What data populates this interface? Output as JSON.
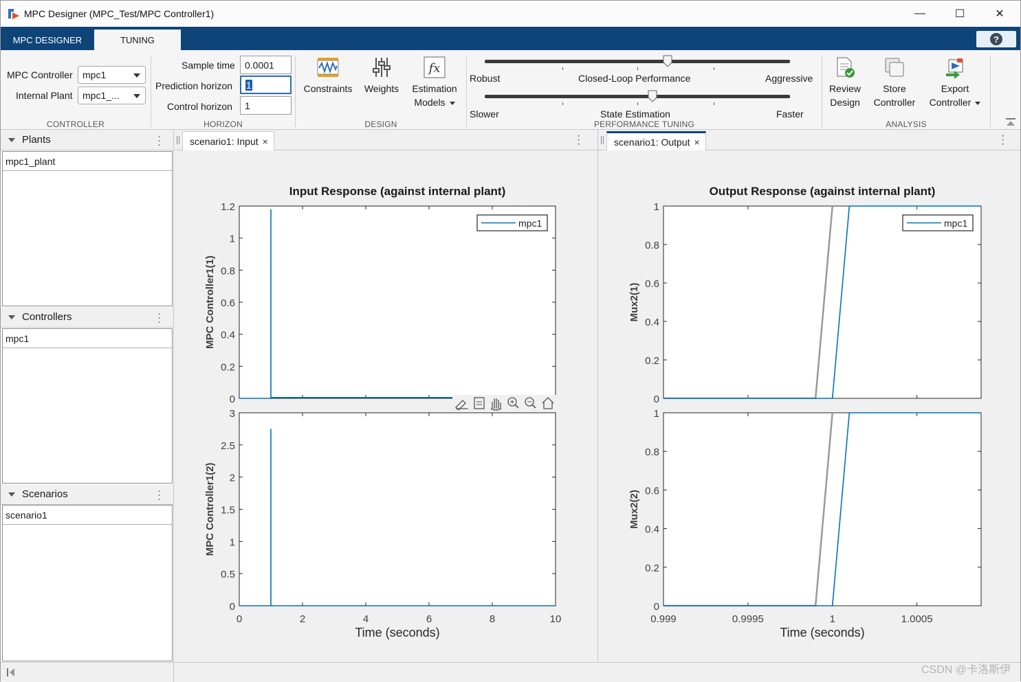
{
  "window": {
    "title": "MPC Designer (MPC_Test/MPC Controller1)",
    "minimize": "—",
    "maximize": "☐",
    "close": "✕"
  },
  "ribbon": {
    "tabs": [
      {
        "label": "MPC DESIGNER"
      },
      {
        "label": "TUNING"
      }
    ],
    "help": "?"
  },
  "controller_section": {
    "title": "CONTROLLER",
    "mpc_controller_label": "MPC Controller",
    "mpc_controller_value": "mpc1",
    "internal_plant_label": "Internal Plant",
    "internal_plant_value": "mpc1_..."
  },
  "horizon_section": {
    "title": "HORIZON",
    "sample_time_label": "Sample time",
    "sample_time_value": "0.0001",
    "prediction_horizon_label": "Prediction horizon",
    "prediction_horizon_value": "1",
    "control_horizon_label": "Control horizon",
    "control_horizon_value": "1"
  },
  "design_section": {
    "title": "DESIGN",
    "constraints": "Constraints",
    "weights": "Weights",
    "estimation_line1": "Estimation",
    "estimation_line2": "Models"
  },
  "performance_section": {
    "title": "PERFORMANCE TUNING",
    "slider1_left": "Robust",
    "slider1_center": "Closed-Loop Performance",
    "slider1_right": "Aggressive",
    "slider1_value": 0.6,
    "slider2_left": "Slower",
    "slider2_center": "State Estimation",
    "slider2_right": "Faster",
    "slider2_value": 0.55
  },
  "analysis_section": {
    "title": "ANALYSIS",
    "review_line1": "Review",
    "review_line2": "Design",
    "store_line1": "Store",
    "store_line2": "Controller",
    "export_line1": "Export",
    "export_line2": "Controller"
  },
  "left_panel": {
    "plants_title": "Plants",
    "plants_item": "mpc1_plant",
    "controllers_title": "Controllers",
    "controllers_item": "mpc1",
    "scenarios_title": "Scenarios",
    "scenarios_item": "scenario1"
  },
  "input_tab": "scenario1: Input",
  "output_tab": "scenario1: Output",
  "tab_close": "×",
  "colors": {
    "accent": "#0e4478",
    "series": "#0072bd",
    "reference": "#999999"
  },
  "watermark": "CSDN @卡洛斯伊",
  "chart_data": [
    {
      "type": "line",
      "title": "Input Response (against internal plant)",
      "xlabel": "Time (seconds)",
      "ylabel": "MPC Controller1(1)",
      "xlim": [
        0,
        10
      ],
      "ylim": [
        0,
        1.2
      ],
      "yticks": [
        0,
        0.2,
        0.4,
        0.6,
        0.8,
        1,
        1.2
      ],
      "ytick_labels": [
        "0",
        "0.2",
        "0.4",
        "0.6",
        "0.8",
        "1",
        "1.2"
      ],
      "xticks": [
        0,
        2,
        4,
        6,
        8,
        10
      ],
      "xtick_labels": [
        "0",
        "2",
        "4",
        "6",
        "8",
        "10"
      ],
      "show_xticklabels": false,
      "legend": "top-right",
      "series": [
        {
          "name": "mpc1",
          "x": [
            0,
            0.999,
            1.0,
            1.0001,
            10
          ],
          "y": [
            0,
            0,
            1.18,
            0.005,
            0.005
          ]
        }
      ]
    },
    {
      "type": "line",
      "title": "",
      "xlabel": "Time (seconds)",
      "ylabel": "MPC Controller1(2)",
      "xlim": [
        0,
        10
      ],
      "ylim": [
        0,
        3
      ],
      "yticks": [
        0,
        0.5,
        1,
        1.5,
        2,
        2.5,
        3
      ],
      "ytick_labels": [
        "0",
        "0.5",
        "1",
        "1.5",
        "2",
        "2.5",
        "3"
      ],
      "xticks": [
        0,
        2,
        4,
        6,
        8,
        10
      ],
      "xtick_labels": [
        "0",
        "2",
        "4",
        "6",
        "8",
        "10"
      ],
      "show_xticklabels": true,
      "series": [
        {
          "name": "mpc1",
          "x": [
            0,
            0.999,
            1.0,
            1.0001,
            10
          ],
          "y": [
            0,
            0,
            2.75,
            0,
            0
          ]
        }
      ]
    },
    {
      "type": "line",
      "title": "Output Response (against internal plant)",
      "xlabel": "Time (seconds)",
      "ylabel": "Mux2(1)",
      "xlim": [
        0.999,
        1.00088
      ],
      "ylim": [
        0,
        1
      ],
      "yticks": [
        0,
        0.2,
        0.4,
        0.6,
        0.8,
        1
      ],
      "ytick_labels": [
        "0",
        "0.2",
        "0.4",
        "0.6",
        "0.8",
        "1"
      ],
      "xticks": [
        0.999,
        0.9995,
        1,
        1.0005
      ],
      "xtick_labels": [
        "0.999",
        "0.9995",
        "1",
        "1.0005"
      ],
      "show_xticklabels": false,
      "legend": "top-right",
      "reference": {
        "x": [
          0.999,
          0.9999,
          1.0
        ],
        "y": [
          0,
          0,
          1
        ]
      },
      "series": [
        {
          "name": "mpc1",
          "x": [
            0.999,
            1.0,
            1.0001,
            1.00088
          ],
          "y": [
            0,
            0,
            1,
            1
          ]
        }
      ]
    },
    {
      "type": "line",
      "title": "",
      "xlabel": "Time (seconds)",
      "ylabel": "Mux2(2)",
      "xlim": [
        0.999,
        1.00088
      ],
      "ylim": [
        0,
        1
      ],
      "yticks": [
        0,
        0.2,
        0.4,
        0.6,
        0.8,
        1
      ],
      "ytick_labels": [
        "0",
        "0.2",
        "0.4",
        "0.6",
        "0.8",
        "1"
      ],
      "xticks": [
        0.999,
        0.9995,
        1,
        1.0005
      ],
      "xtick_labels": [
        "0.999",
        "0.9995",
        "1",
        "1.0005"
      ],
      "show_xticklabels": true,
      "reference": {
        "x": [
          0.999,
          0.9999,
          1.0
        ],
        "y": [
          0,
          0,
          1
        ]
      },
      "series": [
        {
          "name": "mpc1",
          "x": [
            0.999,
            1.0,
            1.0001,
            1.00088
          ],
          "y": [
            0,
            0,
            1,
            1
          ]
        }
      ]
    }
  ]
}
